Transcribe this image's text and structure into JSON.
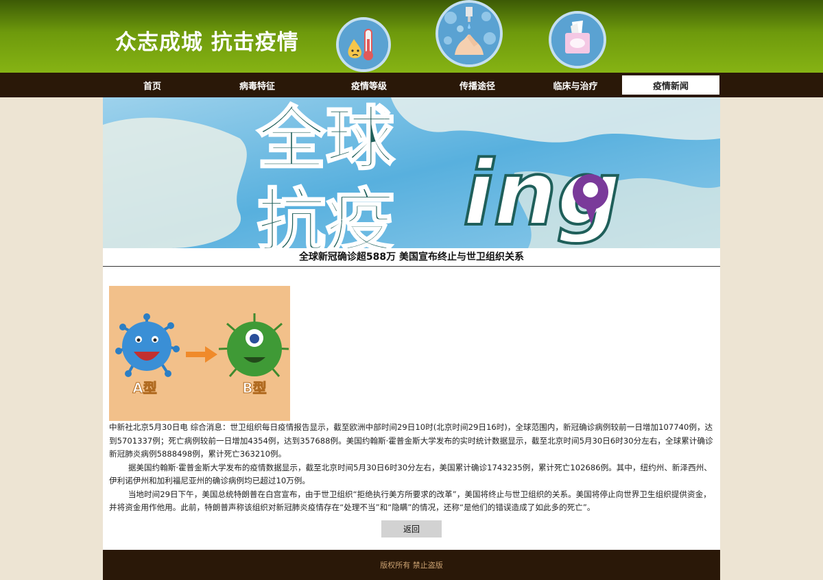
{
  "header": {
    "site_title": "众志成城 抗击疫情",
    "icons": [
      "thermometer-face-icon",
      "hand-washing-icon",
      "tissue-box-icon"
    ]
  },
  "nav": {
    "items": [
      {
        "label": "首页",
        "active": false
      },
      {
        "label": "病毒特征",
        "active": false
      },
      {
        "label": "疫情等级",
        "active": false
      },
      {
        "label": "传播途径",
        "active": false
      },
      {
        "label": "临床与治疗",
        "active": false
      },
      {
        "label": "疫情新闻",
        "active": true
      }
    ]
  },
  "banner": {
    "line1": "全球",
    "line2": "抗疫",
    "suffix": "ing"
  },
  "news": {
    "title": "全球新冠确诊超588万 美国宣布终止与世卫组织关系",
    "image_labels": {
      "left": "A型",
      "right": "B型"
    },
    "paragraphs": [
      "中新社北京5月30日电 综合消息：世卫组织每日疫情报告显示，截至欧洲中部时间29日10时(北京时间29日16时)，全球范围内，新冠确诊病例较前一日增加107740例，达到5701337例；死亡病例较前一日增加4354例，达到357688例。美国约翰斯·霍普金斯大学发布的实时统计数据显示，截至北京时间5月30日6时30分左右，全球累计确诊新冠肺炎病例5888498例，累计死亡363210例。",
      "据美国约翰斯·霍普金斯大学发布的疫情数据显示，截至北京时间5月30日6时30分左右，美国累计确诊1743235例，累计死亡102686例。其中，纽约州、新泽西州、伊利诺伊州和加利福尼亚州的确诊病例均已超过10万例。",
      "当地时间29日下午，美国总统特朗普在白宫宣布，由于世卫组织“拒绝执行美方所要求的改革”，美国将终止与世卫组织的关系。美国将停止向世界卫生组织提供资金，并将资金用作他用。此前，特朗普声称该组织对新冠肺炎疫情存在“处理不当”和“隐瞒”的情况，还称“是他们的错误造成了如此多的死亡”。"
    ],
    "back_label": "返回"
  },
  "footer": {
    "text": "版权所有 禁止盗版"
  }
}
